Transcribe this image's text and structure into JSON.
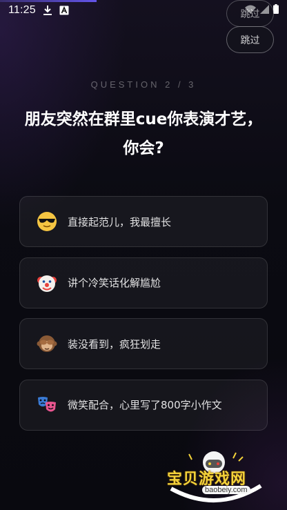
{
  "status_bar": {
    "time": "11:25",
    "icons": [
      "download-icon",
      "a-icon",
      "wifi-icon",
      "signal-icon",
      "battery-icon"
    ]
  },
  "header": {
    "skip_label": "跳过",
    "skip_ghost_label": "跳过"
  },
  "question": {
    "counter": "QUESTION 2 / 3",
    "title": "朋友突然在群里cue你表演才艺，你会?"
  },
  "options": [
    {
      "emoji": "sunglasses-face-icon",
      "label": "直接起范儿，我最擅长"
    },
    {
      "emoji": "clown-face-icon",
      "label": "讲个冷笑话化解尴尬"
    },
    {
      "emoji": "see-no-evil-monkey-icon",
      "label": "装没看到，疯狂划走"
    },
    {
      "emoji": "theater-masks-icon",
      "label": "微笑配合，心里写了800字小作文"
    }
  ],
  "watermark": {
    "text": "宝贝游戏网",
    "url": "baobeiy.com"
  },
  "colors": {
    "background": "#0b0b12",
    "accent": "#6b5cff",
    "card_border": "rgba(255,255,255,0.12)",
    "watermark_yellow": "#f3d23a"
  }
}
